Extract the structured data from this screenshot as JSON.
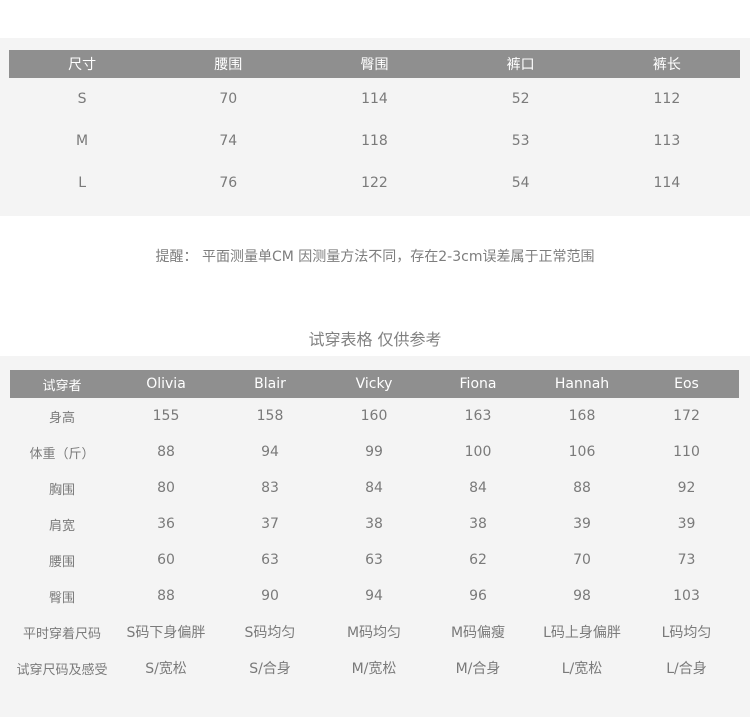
{
  "size_table": {
    "headers": [
      "尺寸",
      "腰围",
      "臀围",
      "裤口",
      "裤长"
    ],
    "rows": [
      [
        "S",
        "70",
        "114",
        "52",
        "112"
      ],
      [
        "M",
        "74",
        "118",
        "53",
        "113"
      ],
      [
        "L",
        "76",
        "122",
        "54",
        "114"
      ]
    ]
  },
  "note": "提醒： 平面测量单CM 因测量方法不同，存在2-3cm误差属于正常范围",
  "try_on": {
    "title": "试穿表格 仅供参考",
    "headers": [
      "试穿者",
      "Olivia",
      "Blair",
      "Vicky",
      "Fiona",
      "Hannah",
      "Eos"
    ],
    "rows": [
      [
        "身高",
        "155",
        "158",
        "160",
        "163",
        "168",
        "172"
      ],
      [
        "体重（斤）",
        "88",
        "94",
        "99",
        "100",
        "106",
        "110"
      ],
      [
        "胸围",
        "80",
        "83",
        "84",
        "84",
        "88",
        "92"
      ],
      [
        "肩宽",
        "36",
        "37",
        "38",
        "38",
        "39",
        "39"
      ],
      [
        "腰围",
        "60",
        "63",
        "63",
        "62",
        "70",
        "73"
      ],
      [
        "臀围",
        "88",
        "90",
        "94",
        "96",
        "98",
        "103"
      ],
      [
        "平时穿着尺码",
        "S码下身偏胖",
        "S码均匀",
        "M码均匀",
        "M码偏瘦",
        "L码上身偏胖",
        "L码均匀"
      ],
      [
        "试穿尺码及感受",
        "S/宽松",
        "S/合身",
        "M/宽松",
        "M/合身",
        "L/宽松",
        "L/合身"
      ]
    ]
  }
}
